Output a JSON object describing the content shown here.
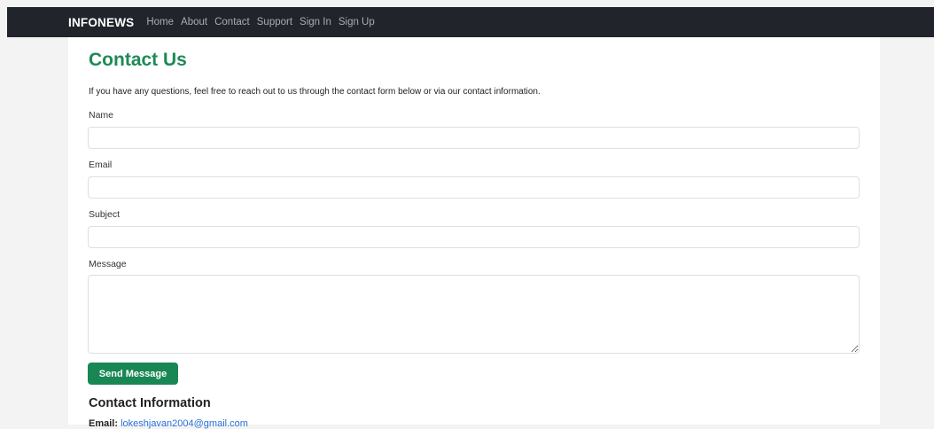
{
  "navbar": {
    "brand": "INFONEWS",
    "links": [
      "Home",
      "About",
      "Contact",
      "Support",
      "Sign In",
      "Sign Up"
    ]
  },
  "page": {
    "title": "Contact Us",
    "intro": "If you have any questions, feel free to reach out to us through the contact form below or via our contact information."
  },
  "form": {
    "name_label": "Name",
    "name_value": "",
    "email_label": "Email",
    "email_value": "",
    "subject_label": "Subject",
    "subject_value": "",
    "message_label": "Message",
    "message_value": "",
    "submit_label": "Send Message"
  },
  "contact_info": {
    "title": "Contact Information",
    "email_label": "Email:",
    "email": "lokeshjavan2004@gmail.com"
  },
  "colors": {
    "navbar_bg": "#21252b",
    "accent_green": "#198754",
    "title_green": "#1e8a54",
    "link_blue": "#2a6fdb"
  }
}
